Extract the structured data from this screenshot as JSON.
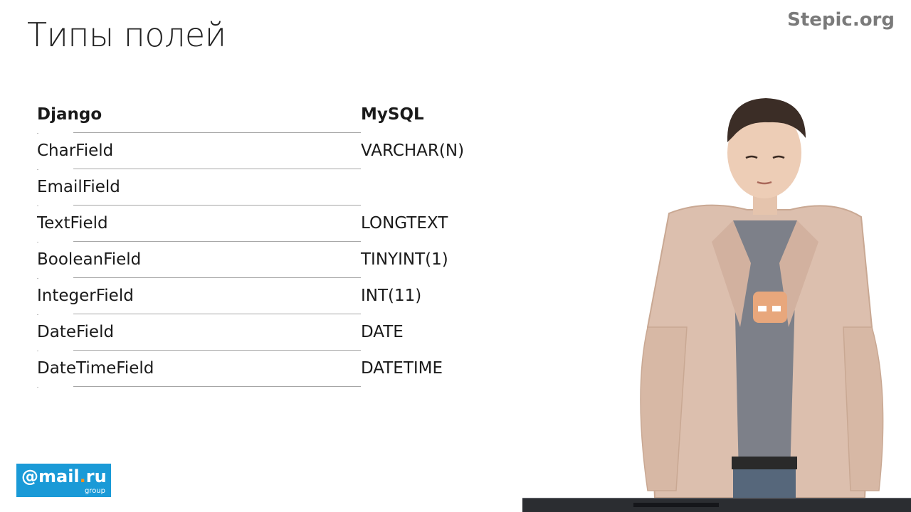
{
  "slide": {
    "title": "Типы полей",
    "brand": "Stepic.org"
  },
  "table": {
    "headers": {
      "django": "Django",
      "mysql": "MySQL"
    },
    "rows": [
      {
        "django": "CharField",
        "mysql": "VARCHAR(N)"
      },
      {
        "django": "EmailField",
        "mysql": ""
      },
      {
        "django": "TextField",
        "mysql": "LONGTEXT"
      },
      {
        "django": "BooleanField",
        "mysql": "TINYINT(1)"
      },
      {
        "django": "IntegerField",
        "mysql": "INT(11)"
      },
      {
        "django": "DateField",
        "mysql": "DATE"
      },
      {
        "django": "DateTimeField",
        "mysql": "DATETIME"
      }
    ]
  },
  "logo": {
    "main_prefix": "@mail",
    "main_dot": ".",
    "main_suffix": "ru",
    "sub": "group"
  },
  "colors": {
    "brand_text": "#7a7a7a",
    "logo_background": "#1a9ad7",
    "separator": "#a6a6a6"
  },
  "presenter": {
    "icon": "person-photo"
  }
}
